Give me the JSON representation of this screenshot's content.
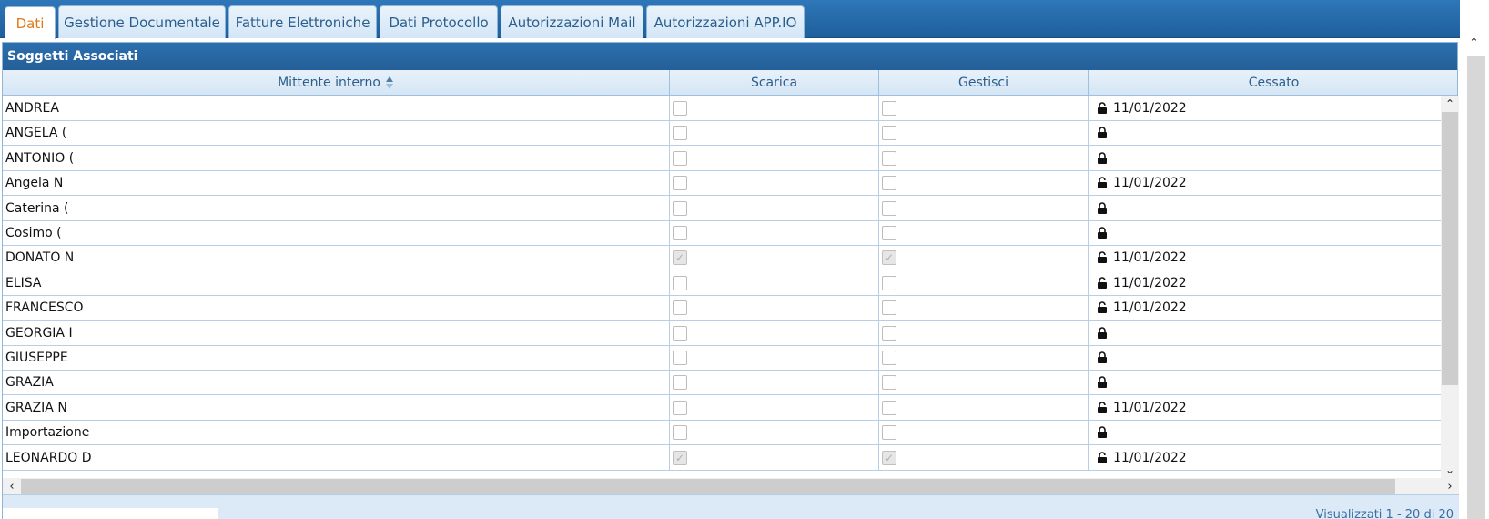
{
  "tabs": [
    {
      "label": "Dati",
      "active": true
    },
    {
      "label": "Gestione Documentale",
      "active": false
    },
    {
      "label": "Fatture Elettroniche",
      "active": false
    },
    {
      "label": "Dati Protocollo",
      "active": false
    },
    {
      "label": "Autorizzazioni Mail",
      "active": false
    },
    {
      "label": "Autorizzazioni APP.IO",
      "active": false
    }
  ],
  "panel": {
    "title": "Soggetti Associati",
    "columns": {
      "name": "Mittente interno",
      "scarica": "Scarica",
      "gestisci": "Gestisci",
      "cessato": "Cessato"
    }
  },
  "rows": [
    {
      "name": "ANDREA",
      "scarica": false,
      "gestisci": false,
      "lock": "open",
      "date": "11/01/2022"
    },
    {
      "name": "ANGELA (",
      "scarica": false,
      "gestisci": false,
      "lock": "closed",
      "date": ""
    },
    {
      "name": "ANTONIO (",
      "scarica": false,
      "gestisci": false,
      "lock": "closed",
      "date": ""
    },
    {
      "name": "Angela N",
      "scarica": false,
      "gestisci": false,
      "lock": "open",
      "date": "11/01/2022"
    },
    {
      "name": "Caterina (",
      "scarica": false,
      "gestisci": false,
      "lock": "closed",
      "date": ""
    },
    {
      "name": "Cosimo (",
      "scarica": false,
      "gestisci": false,
      "lock": "closed",
      "date": ""
    },
    {
      "name": "DONATO N",
      "scarica": true,
      "gestisci": true,
      "lock": "open",
      "date": "11/01/2022"
    },
    {
      "name": "ELISA",
      "scarica": false,
      "gestisci": false,
      "lock": "open",
      "date": "11/01/2022"
    },
    {
      "name": "FRANCESCO",
      "scarica": false,
      "gestisci": false,
      "lock": "open",
      "date": "11/01/2022"
    },
    {
      "name": "GEORGIA I",
      "scarica": false,
      "gestisci": false,
      "lock": "closed",
      "date": ""
    },
    {
      "name": "GIUSEPPE",
      "scarica": false,
      "gestisci": false,
      "lock": "closed",
      "date": ""
    },
    {
      "name": "GRAZIA",
      "scarica": false,
      "gestisci": false,
      "lock": "closed",
      "date": ""
    },
    {
      "name": "GRAZIA N",
      "scarica": false,
      "gestisci": false,
      "lock": "open",
      "date": "11/01/2022"
    },
    {
      "name": "Importazione",
      "scarica": false,
      "gestisci": false,
      "lock": "closed",
      "date": ""
    },
    {
      "name": "LEONARDO D",
      "scarica": true,
      "gestisci": true,
      "lock": "open",
      "date": "11/01/2022"
    }
  ],
  "footer": {
    "status": "Visualizzati 1 - 20 di 20"
  },
  "colors": {
    "tab_active_text": "#e07a18",
    "header_blue": "#2c6fae",
    "link_blue": "#2b5e8c"
  }
}
